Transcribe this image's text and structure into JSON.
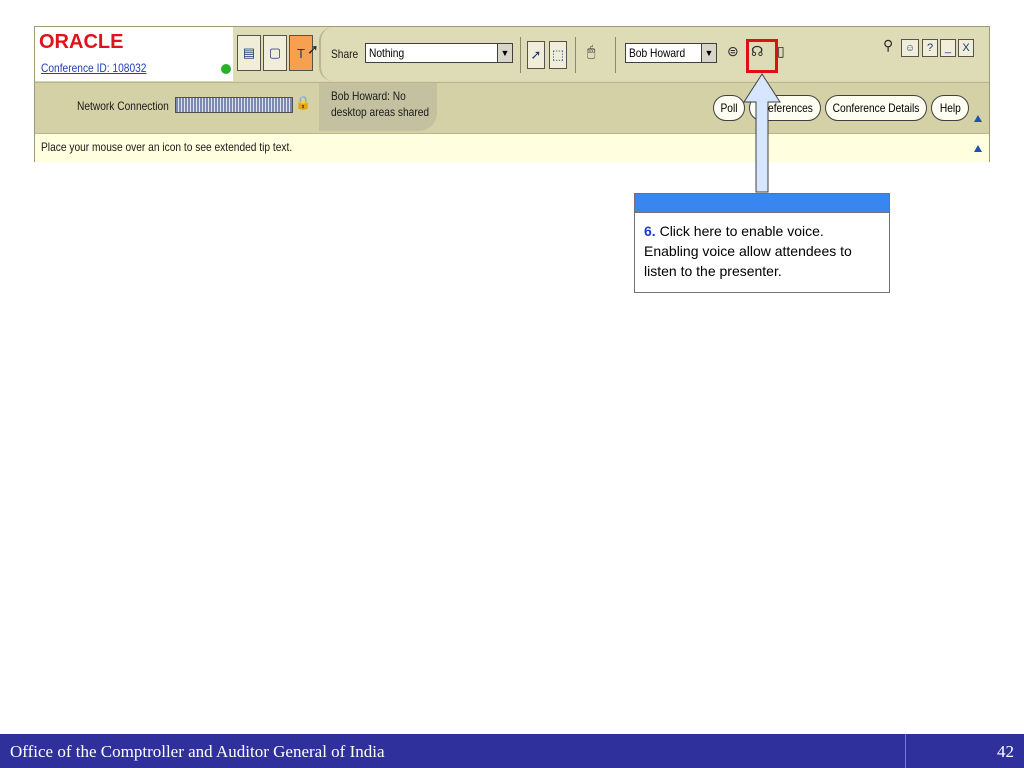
{
  "app": {
    "logo_text": "ORACLE",
    "conference_id": "Conference ID: 108032"
  },
  "toolbar": {
    "share_label": "Share",
    "share_value": "Nothing",
    "presenter_value": "Bob Howard"
  },
  "status_row": {
    "network_label": "Network Connection",
    "share_status": "Bob Howard: No desktop areas shared",
    "share_status_line1": "Bob Howard: No",
    "share_status_line2": "desktop areas shared",
    "buttons": {
      "poll": "Poll",
      "preferences": "Preferences",
      "conference_details": "Conference Details",
      "help": "Help"
    }
  },
  "tip_bar": {
    "text": "Place your mouse over an icon to see extended tip text."
  },
  "callout": {
    "step": "6.",
    "text": "Click here to enable voice. Enabling voice allow attendees to listen to the presenter."
  },
  "footer": {
    "title": "Office of the Comptroller and Auditor General of India",
    "page": "42"
  },
  "colors": {
    "footer_bg": "#30309c",
    "highlight": "#e01010",
    "callout_header": "#3a86f0"
  }
}
